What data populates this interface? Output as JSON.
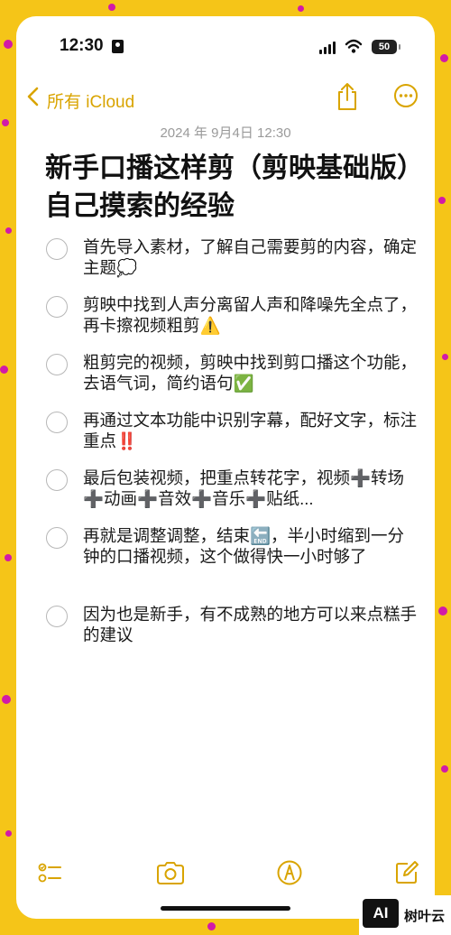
{
  "status_bar": {
    "time": "12:30",
    "battery": "50"
  },
  "nav": {
    "back_label": "所有 iCloud"
  },
  "note": {
    "date": "2024 年 9月4日 12:30",
    "title": "新手口播这样剪（剪映基础版）自己摸索的经验",
    "items": [
      {
        "text": "首先导入素材，了解自己需要剪的内容，确定主题💭"
      },
      {
        "text": "剪映中找到人声分离留人声和降噪先全点了，再卡擦视频粗剪⚠️"
      },
      {
        "text": "粗剪完的视频，剪映中找到剪口播这个功能，去语气词，简约语句✅"
      },
      {
        "text": "再通过文本功能中识别字幕，配好文字，标注重点‼️"
      },
      {
        "text": "最后包装视频，把重点转花字，视频➕转场➕动画➕音效➕音乐➕贴纸..."
      },
      {
        "text": "再就是调整调整，结束🔚，半小时缩到一分钟的口播视频，这个做得快一小时够了"
      },
      {
        "text": "因为也是新手，有不成熟的地方可以来点糕手的建议"
      }
    ]
  },
  "watermark": {
    "logo": "AI",
    "text": "树叶云"
  },
  "colors": {
    "accent": "#d9a400",
    "background": "#f5c518",
    "dots": "#d21aa8"
  }
}
